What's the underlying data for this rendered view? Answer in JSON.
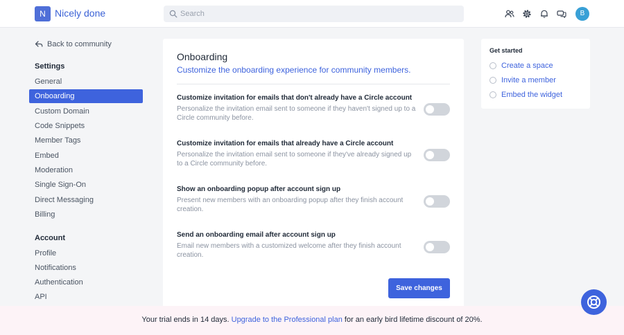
{
  "app": {
    "logo_letter": "N",
    "name": "Nicely done"
  },
  "search": {
    "placeholder": "Search"
  },
  "header": {
    "avatar_letter": "B"
  },
  "sidebar": {
    "back_label": "Back to community",
    "settings_heading": "Settings",
    "settings_items": [
      {
        "label": "General"
      },
      {
        "label": "Onboarding"
      },
      {
        "label": "Custom Domain"
      },
      {
        "label": "Code Snippets"
      },
      {
        "label": "Member Tags"
      },
      {
        "label": "Embed"
      },
      {
        "label": "Moderation"
      },
      {
        "label": "Single Sign-On"
      },
      {
        "label": "Direct Messaging"
      },
      {
        "label": "Billing"
      }
    ],
    "account_heading": "Account",
    "account_items": [
      {
        "label": "Profile"
      },
      {
        "label": "Notifications"
      },
      {
        "label": "Authentication"
      },
      {
        "label": "API"
      }
    ]
  },
  "main": {
    "title": "Onboarding",
    "subtitle": "Customize the onboarding experience for community members.",
    "settings": [
      {
        "title": "Customize invitation for emails that don't already have a Circle account",
        "description": "Personalize the invitation email sent to someone if they haven't signed up to a Circle community before.",
        "enabled": false
      },
      {
        "title": "Customize invitation for emails that already have a Circle account",
        "description": "Personalize the invitation email sent to someone if they've already signed up to a Circle community before.",
        "enabled": false
      },
      {
        "title": "Show an onboarding popup after account sign up",
        "description": "Present new members with an onboarding popup after they finish account creation.",
        "enabled": false
      },
      {
        "title": "Send an onboarding email after account sign up",
        "description": "Email new members with a customized welcome after they finish account creation.",
        "enabled": false
      }
    ],
    "save_label": "Save changes"
  },
  "get_started": {
    "title": "Get started",
    "items": [
      {
        "label": "Create a space"
      },
      {
        "label": "Invite a member"
      },
      {
        "label": "Embed the widget"
      }
    ]
  },
  "trial": {
    "prefix": "Your trial ends in 14 days.",
    "link": "Upgrade to the Professional plan",
    "suffix": "for an early bird lifetime discount of 20%."
  },
  "icons": {
    "search": "search-icon",
    "members": "members-icon",
    "settings": "gear-icon",
    "notifications": "bell-icon",
    "messages": "chat-icon",
    "back": "back-arrow-icon",
    "help": "lifebuoy-icon"
  },
  "colors": {
    "accent": "#3e63dd",
    "toggle_off": "#d1d5db",
    "banner": "#fdf3f7"
  }
}
